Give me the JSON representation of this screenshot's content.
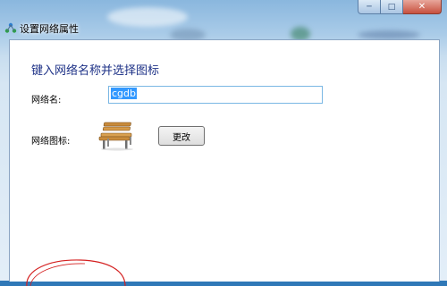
{
  "window": {
    "title": "设置网络属性",
    "caption_min": "─",
    "caption_max": "□",
    "caption_close": "✕"
  },
  "dialog": {
    "heading": "键入网络名称并选择图标",
    "network_name_label": "网络名:",
    "network_name_value": "cgdb",
    "network_icon_label": "网络图标:",
    "network_icon": "bench-icon",
    "change_button_label": "更改"
  },
  "colors": {
    "heading": "#1e3287",
    "selection": "#3399ff",
    "annotation": "#d42020"
  }
}
